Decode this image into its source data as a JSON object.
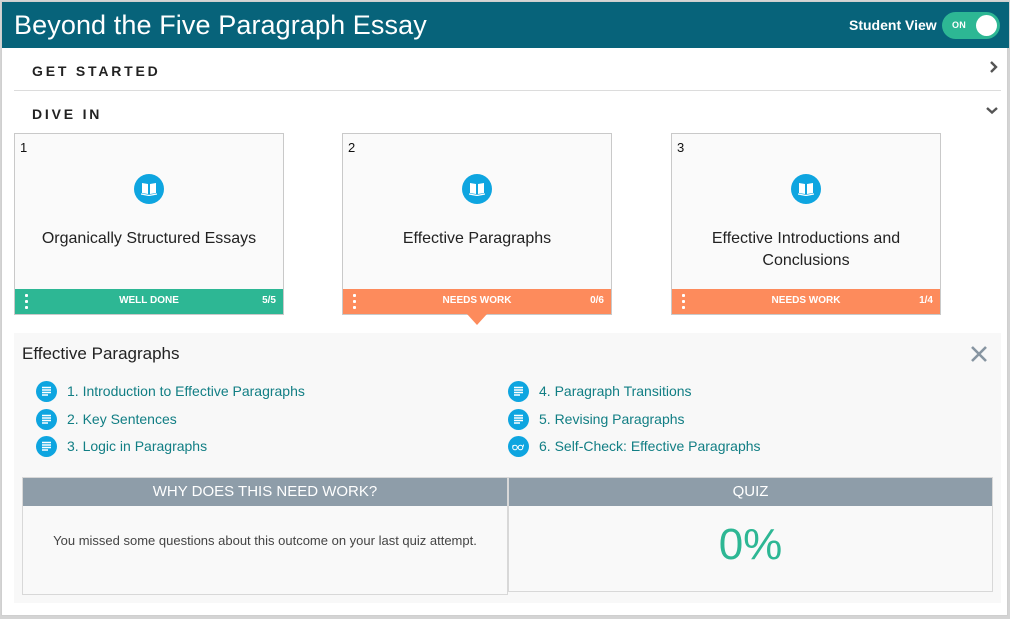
{
  "header": {
    "title": "Beyond the Five Paragraph Essay",
    "student_view_label": "Student View",
    "toggle_state": "ON"
  },
  "sections": [
    {
      "label": "GET STARTED",
      "state": "collapsed",
      "icon": "chevron-right-icon"
    },
    {
      "label": "DIVE IN",
      "state": "expanded",
      "icon": "chevron-down-icon"
    }
  ],
  "cards": [
    {
      "number": "1",
      "title": "Organically Structured Essays",
      "icon": "open-book-icon",
      "status": "WELL DONE",
      "count": "5/5",
      "status_color": "#2db794"
    },
    {
      "number": "2",
      "title": "Effective Paragraphs",
      "icon": "open-book-icon",
      "status": "NEEDS WORK",
      "count": "0/6",
      "status_color": "#fd8b5c",
      "selected": true
    },
    {
      "number": "3",
      "title": "Effective Introductions and Conclusions",
      "icon": "open-book-icon",
      "status": "NEEDS WORK",
      "count": "1/4",
      "status_color": "#fd8b5c"
    }
  ],
  "detail": {
    "title": "Effective Paragraphs",
    "close_icon": "close-icon",
    "lessons": [
      {
        "label": "1. Introduction to Effective Paragraphs",
        "icon": "document-icon"
      },
      {
        "label": "2. Key Sentences",
        "icon": "document-icon"
      },
      {
        "label": "3. Logic in Paragraphs",
        "icon": "document-icon"
      },
      {
        "label": "4. Paragraph Transitions",
        "icon": "document-icon"
      },
      {
        "label": "5. Revising Paragraphs",
        "icon": "document-icon"
      },
      {
        "label": "6. Self-Check: Effective Paragraphs",
        "icon": "glasses-icon"
      }
    ],
    "why": {
      "heading": "WHY DOES THIS NEED WORK?",
      "text": "You missed some questions about this outcome on your last quiz attempt."
    },
    "quiz": {
      "heading": "QUIZ",
      "value": "0%"
    }
  },
  "colors": {
    "header_bg": "#07637a",
    "success": "#2db794",
    "warning": "#fd8b5c",
    "icon_blue": "#0ea5e0",
    "link_teal": "#117e84",
    "box_header": "#8e9da9"
  }
}
